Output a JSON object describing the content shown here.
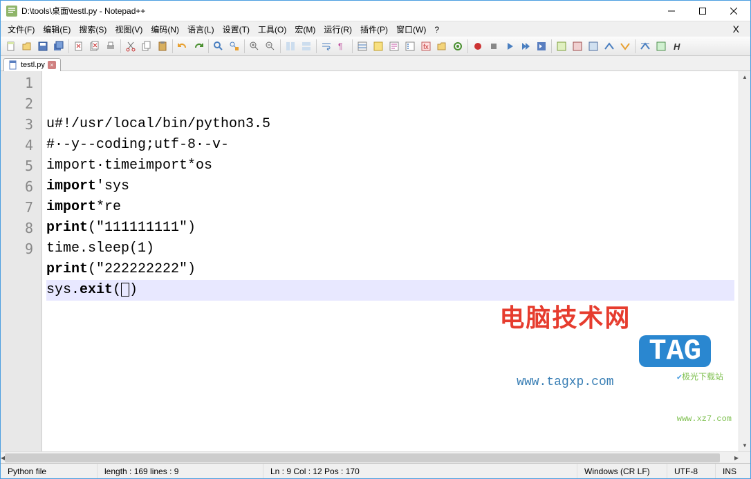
{
  "title": "D:\\tools\\桌面\\testl.py - Notepad++",
  "menus": [
    "文件(F)",
    "编辑(E)",
    "搜索(S)",
    "视图(V)",
    "编码(N)",
    "语言(L)",
    "设置(T)",
    "工具(O)",
    "宏(M)",
    "运行(R)",
    "插件(P)",
    "窗口(W)",
    "?"
  ],
  "tab": {
    "label": "testl.py"
  },
  "code": {
    "lines": [
      {
        "n": "1",
        "segs": [
          {
            "t": "u#!/usr/local/bin/python3.5"
          }
        ]
      },
      {
        "n": "2",
        "segs": [
          {
            "t": "#·-y--coding;utf-8·-v-"
          }
        ]
      },
      {
        "n": "3",
        "segs": [
          {
            "t": "import·timeimport*os"
          }
        ]
      },
      {
        "n": "4",
        "segs": [
          {
            "t": "import",
            "kw": true
          },
          {
            "t": "'sys"
          }
        ]
      },
      {
        "n": "5",
        "segs": [
          {
            "t": "import",
            "kw": true
          },
          {
            "t": "*re"
          }
        ]
      },
      {
        "n": "6",
        "segs": [
          {
            "t": "print",
            "kw": true
          },
          {
            "t": "(\"111111111\")"
          }
        ]
      },
      {
        "n": "7",
        "segs": [
          {
            "t": "time.sleep(1)"
          }
        ]
      },
      {
        "n": "8",
        "segs": [
          {
            "t": "print",
            "kw": true
          },
          {
            "t": "(\"222222222\")"
          }
        ]
      },
      {
        "n": "9",
        "segs": [
          {
            "t": "sys."
          },
          {
            "t": "exit",
            "kw": true
          },
          {
            "t": "("
          },
          {
            "cursor": true
          },
          {
            "t": ")"
          }
        ],
        "current": true
      }
    ]
  },
  "status": {
    "lang": "Python file",
    "length": "length : 169    lines : 9",
    "pos": "Ln : 9    Col : 12    Pos : 170",
    "eol": "Windows (CR LF)",
    "enc": "UTF-8",
    "ins": "INS"
  },
  "watermark": {
    "t1": "电脑技术网",
    "t2": "www.tagxp.com",
    "tag": "TAG",
    "sub1": "极光下载站",
    "sub2": "www.xz7.com"
  }
}
